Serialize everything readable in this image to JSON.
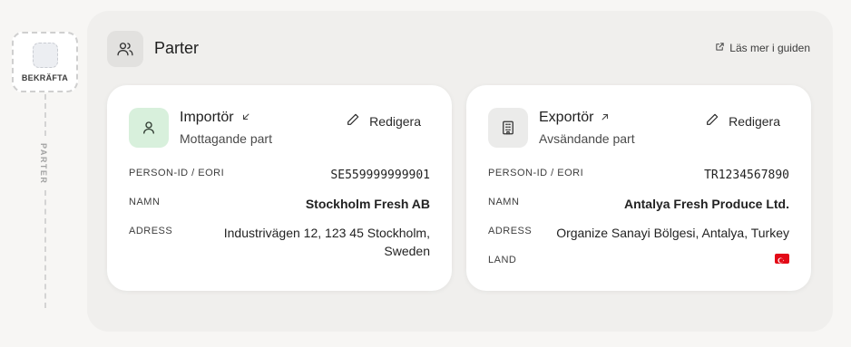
{
  "rail": {
    "step_label": "BEKRÄFTA",
    "section_label": "PARTER"
  },
  "header": {
    "title": "Parter",
    "guide_link": "Läs mer i guiden",
    "icon": "users-icon"
  },
  "importer": {
    "title": "Importör",
    "subtitle": "Mottagande part",
    "edit_label": "Redigera",
    "icon": "person-icon",
    "direction_icon": "arrow-down-left-icon",
    "fields": {
      "id_label": "PERSON-ID / EORI",
      "id_value": "SE559999999901",
      "name_label": "NAMN",
      "name_value": "Stockholm Fresh AB",
      "address_label": "ADRESS",
      "address_line1": "Industrivägen 12, 123 45 Stockholm,",
      "address_line2": "Sweden"
    }
  },
  "exporter": {
    "title": "Exportör",
    "subtitle": "Avsändande part",
    "edit_label": "Redigera",
    "icon": "building-icon",
    "direction_icon": "arrow-up-right-icon",
    "fields": {
      "id_label": "PERSON-ID / EORI",
      "id_value": "TR1234567890",
      "name_label": "NAMN",
      "name_value": "Antalya Fresh Produce Ltd.",
      "address_label": "ADRESS",
      "address_value": "Organize Sanayi Bölgesi, Antalya, Turkey",
      "country_label": "LAND",
      "country_flag": "turkey-flag"
    }
  },
  "colors": {
    "importer_icon_bg": "#d8f0dc",
    "exporter_icon_bg": "#ebebea",
    "panel_bg": "#f0efed",
    "flag_red": "#e30a17"
  }
}
